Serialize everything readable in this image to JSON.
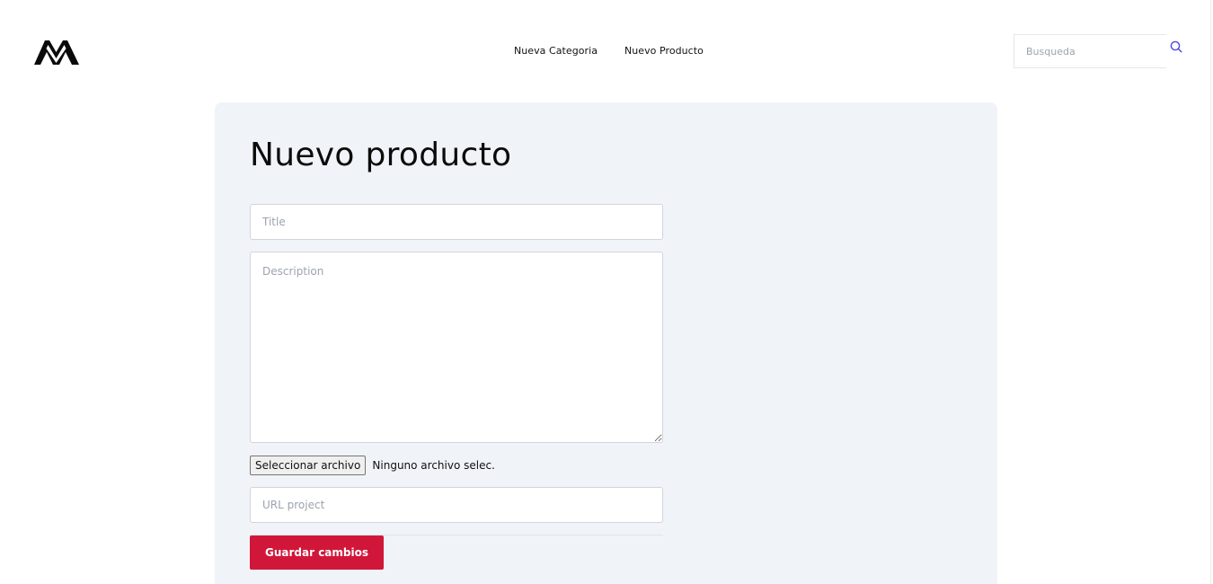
{
  "header": {
    "logo_icon": "mountain-logo-icon",
    "nav": [
      {
        "label": "Nueva Categoria"
      },
      {
        "label": "Nuevo Producto"
      }
    ],
    "search": {
      "placeholder": "Busqueda",
      "value": "",
      "icon": "search-icon",
      "icon_color": "#4f46e5"
    }
  },
  "form": {
    "title": "Nuevo producto",
    "title_field": {
      "placeholder": "Title",
      "value": ""
    },
    "description_field": {
      "placeholder": "Description",
      "value": ""
    },
    "file_input": {
      "button_label": "Seleccionar archivo",
      "status_text": "Ninguno archivo selec."
    },
    "url_field": {
      "placeholder": "URL project",
      "value": ""
    },
    "submit_label": "Guardar cambios",
    "submit_color": "#d0173a",
    "card_background": "#f0f3f8"
  }
}
